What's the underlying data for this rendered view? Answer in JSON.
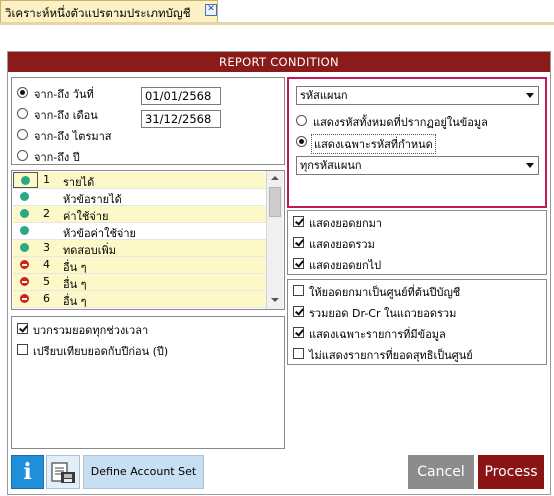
{
  "tab": {
    "title": "วิเคราะห์หนึ่งตัวแปรตามประเภทบัญชี",
    "close_glyph": "✕"
  },
  "header": {
    "title": "REPORT CONDITION"
  },
  "period": {
    "options": [
      {
        "label": "จาก-ถึง วันที่",
        "selected": true
      },
      {
        "label": "จาก-ถึง เดือน",
        "selected": false
      },
      {
        "label": "จาก-ถึง ไตรมาส",
        "selected": false
      },
      {
        "label": "จาก-ถึง ปี",
        "selected": false
      }
    ],
    "from_date": "01/01/2568",
    "to_date": "31/12/2568"
  },
  "code_filter": {
    "type_select": "รหัสแผนก",
    "options": [
      {
        "label": "แสดงรหัสทั้งหมดที่ปรากฏอยู่ในข้อมูล",
        "selected": false
      },
      {
        "label": "แสดงเฉพาะรหัสที่กำหนด",
        "selected": true
      }
    ],
    "value_select": "ทุกรหัสแผนก"
  },
  "account_grid": {
    "rows": [
      {
        "marker": "green",
        "num": "1",
        "name": "รายได้",
        "highlight": true,
        "selected": true
      },
      {
        "marker": "green",
        "num": "",
        "name": "หัวข้อรายได้",
        "highlight": false
      },
      {
        "marker": "green",
        "num": "2",
        "name": "ค่าใช้จ่าย",
        "highlight": true
      },
      {
        "marker": "green",
        "num": "",
        "name": "หัวข้อค่าใช้จ่าย",
        "highlight": false
      },
      {
        "marker": "green",
        "num": "3",
        "name": "ทดสอบเพิ่ม",
        "highlight": true
      },
      {
        "marker": "red",
        "num": "4",
        "name": "อื่น ๆ",
        "highlight": true
      },
      {
        "marker": "red",
        "num": "5",
        "name": "อื่น ๆ",
        "highlight": true
      },
      {
        "marker": "red",
        "num": "6",
        "name": "อื่น ๆ",
        "highlight": true
      }
    ]
  },
  "balance_options": [
    {
      "label": "แสดงยอดยกมา",
      "checked": true
    },
    {
      "label": "แสดงยอดรวม",
      "checked": true
    },
    {
      "label": "แสดงยอดยกไป",
      "checked": true
    }
  ],
  "compare_options": [
    {
      "label": "บวกรวมยอดทุกช่วงเวลา",
      "checked": true
    },
    {
      "label": "เปรียบเทียบยอดกับปีก่อน (ปี)",
      "checked": false
    }
  ],
  "extra_options": [
    {
      "label": "ให้ยอดยกมาเป็นศูนย์ที่ต้นปีบัญชี",
      "checked": false
    },
    {
      "label": "รวมยอด Dr-Cr ในแถวยอดรวม",
      "checked": true
    },
    {
      "label": "แสดงเฉพาะรายการที่มีข้อมูล",
      "checked": true
    },
    {
      "label": "ไม่แสดงรายการที่ยอดสุทธิเป็นศูนย์",
      "checked": false
    }
  ],
  "footer": {
    "info_glyph": "i",
    "define_account_set": "Define Account Set",
    "cancel": "Cancel",
    "process": "Process"
  },
  "colors": {
    "header_bg": "#8b1a1a",
    "highlight_border": "#c2185b",
    "row_highlight": "#fdf8c8",
    "process_bg": "#8a1414",
    "cancel_bg": "#8c8c8c",
    "info_bg": "#1e8fd8"
  }
}
